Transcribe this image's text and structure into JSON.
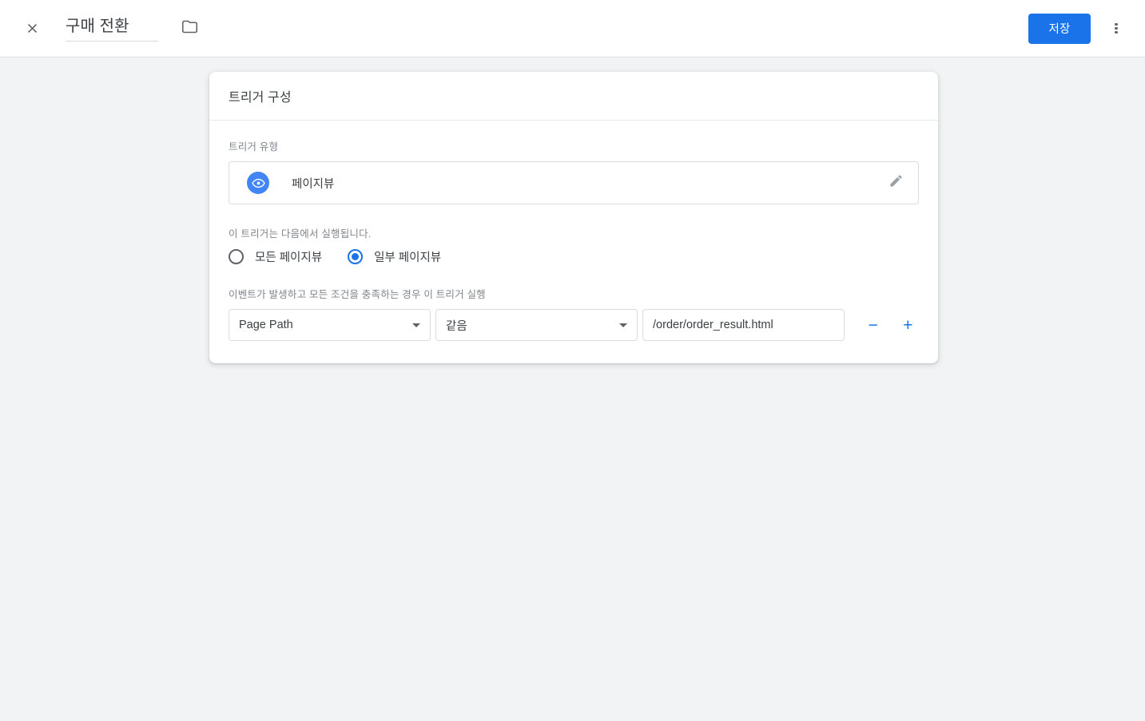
{
  "header": {
    "close_icon": "close-icon",
    "title": "구매 전환",
    "folder_icon": "folder-icon",
    "save_label": "저장",
    "more_icon": "more-vertical-icon",
    "accent_color": "#1a73e8"
  },
  "card": {
    "title": "트리거 구성",
    "trigger_type": {
      "label": "트리거 유형",
      "icon": "eye-icon",
      "icon_color": "#4285f4",
      "name": "페이지뷰",
      "edit_icon": "pencil-icon"
    },
    "fire_on": {
      "label": "이 트리거는 다음에서 실행됩니다.",
      "options": [
        {
          "label": "모든 페이지뷰",
          "selected": false
        },
        {
          "label": "일부 페이지뷰",
          "selected": true
        }
      ]
    },
    "conditions": {
      "label": "이벤트가 발생하고 모든 조건을 충족하는 경우 이 트리거 실행",
      "rows": [
        {
          "variable": "Page Path",
          "operator": "같음",
          "value": "/order/order_result.html",
          "remove_label": "−",
          "add_label": "+"
        }
      ]
    }
  }
}
